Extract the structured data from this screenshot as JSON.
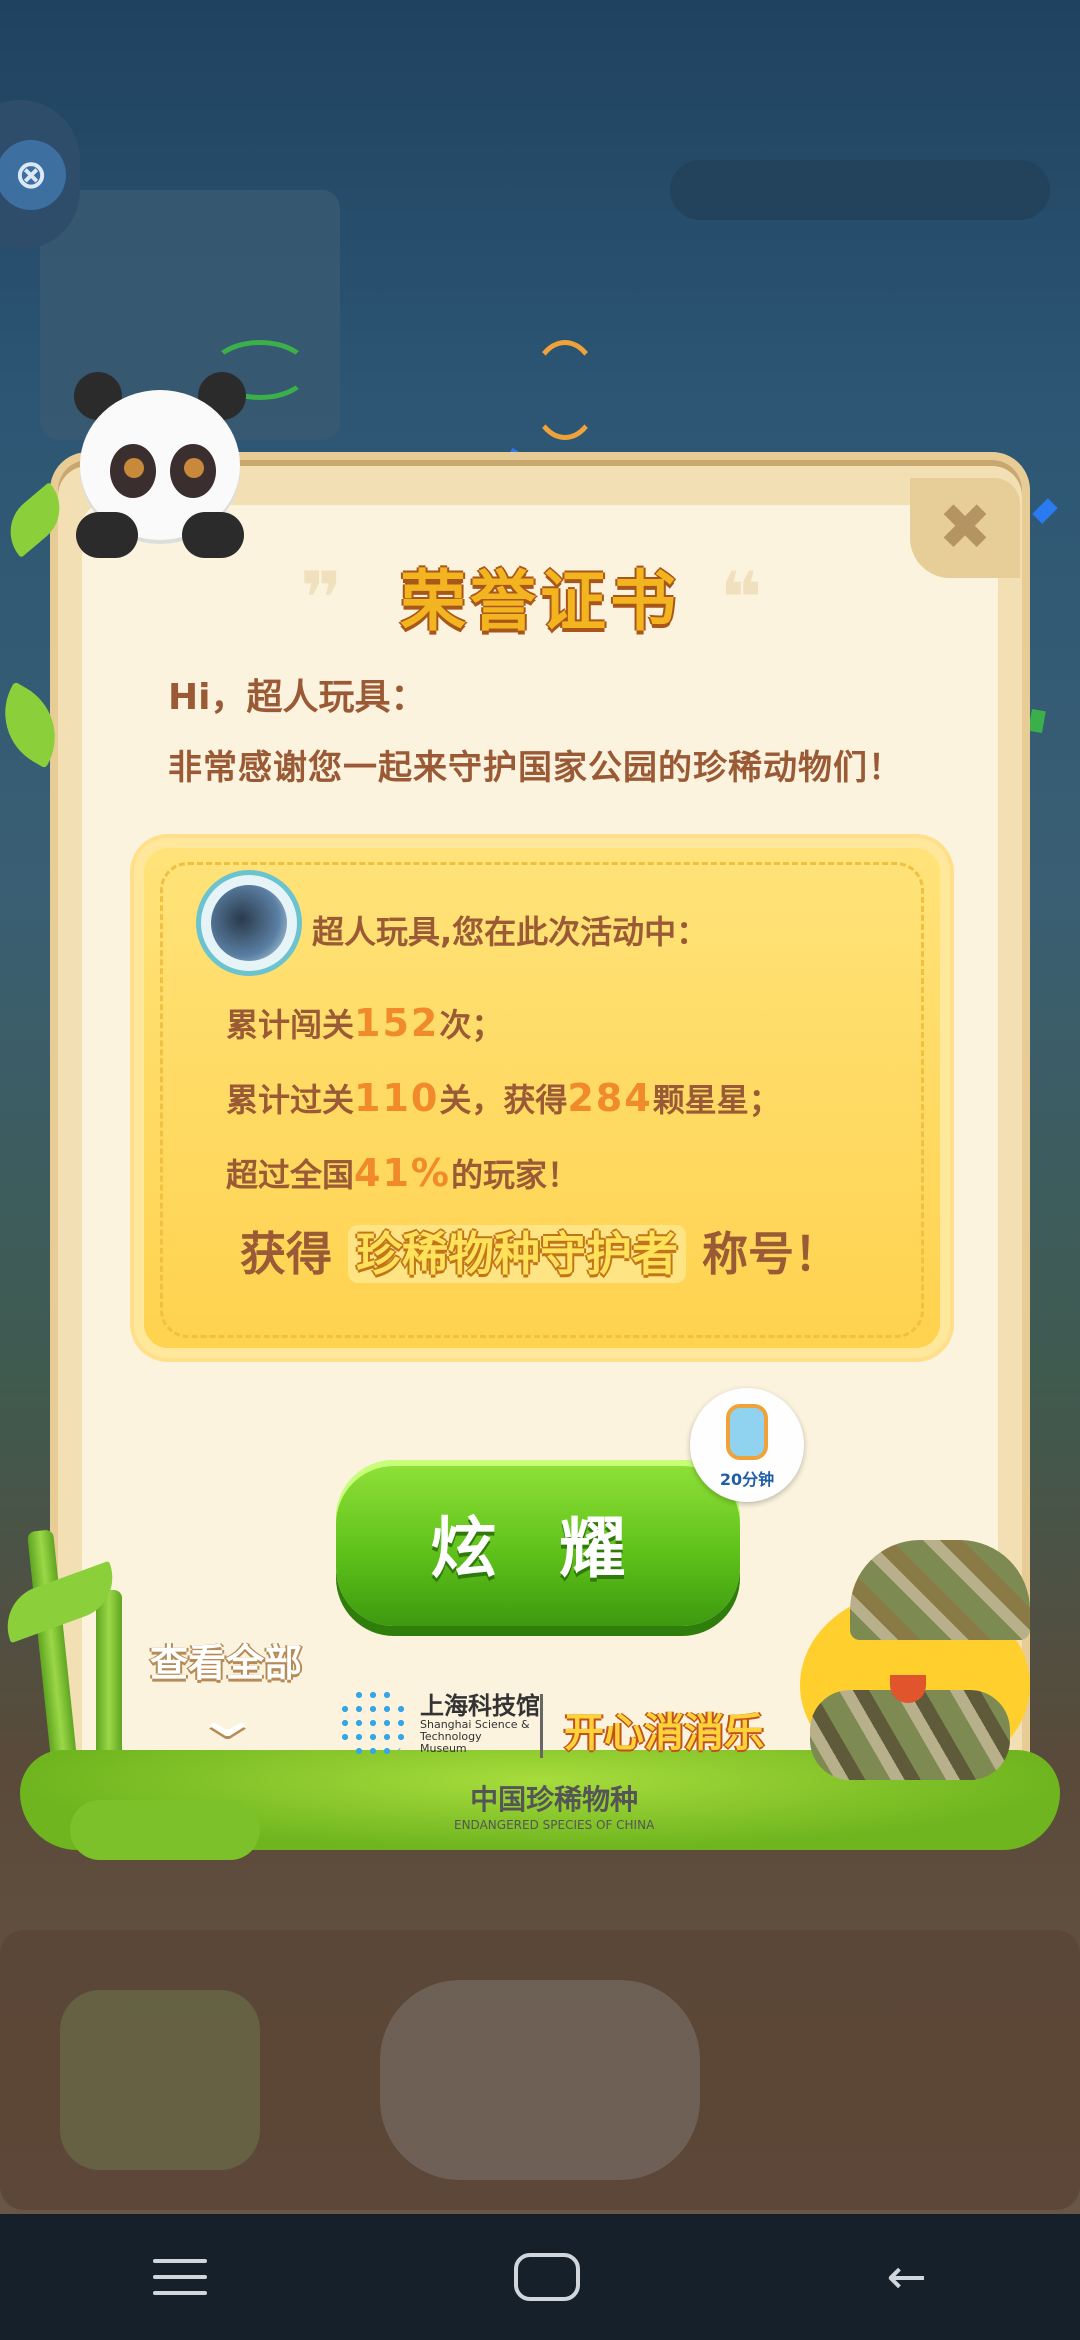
{
  "certificate": {
    "title": "荣誉证书",
    "greeting": "Hi，超人玩具：",
    "thanks": "非常感谢您一起来守护国家公园的珍稀动物们！",
    "player_line": "超人玩具,您在此次活动中：",
    "rows": {
      "r1_pre": "累计闯关",
      "r1_num": "152",
      "r1_post": "次；",
      "r2_pre": "累计过关",
      "r2_num": "110",
      "r2_mid": "关，获得",
      "r2_num2": "284",
      "r2_post": "颗星星；",
      "r3_pre": "超过全国",
      "r3_num": "41%",
      "r3_post": "的玩家！"
    },
    "award_pre": "获得",
    "award_title": "珍稀物种守护者",
    "award_post": "称号！"
  },
  "actions": {
    "share_label": "炫 耀",
    "timer_label": "20分钟",
    "view_all_label": "查看全部",
    "close_symbol": "✖",
    "exit_symbol": "⊗"
  },
  "logos": {
    "museum_cn": "上海科技馆",
    "museum_en": "Shanghai Science & Technology Museum",
    "game_name": "开心消消乐",
    "series_cn": "中国珍稀物种",
    "series_en": "ENDANGERED SPECIES OF CHINA"
  },
  "icons": {
    "exit": "exit-icon",
    "close": "close-icon",
    "chevron": "chevron-down-icon",
    "nav_menu": "menu-icon",
    "nav_home": "home-icon",
    "nav_back": "back-icon"
  },
  "colors": {
    "accent_orange": "#f08a2a",
    "text_brown": "#9a5a35",
    "button_green": "#5fc21a",
    "title_gold": "#f2b41f"
  }
}
